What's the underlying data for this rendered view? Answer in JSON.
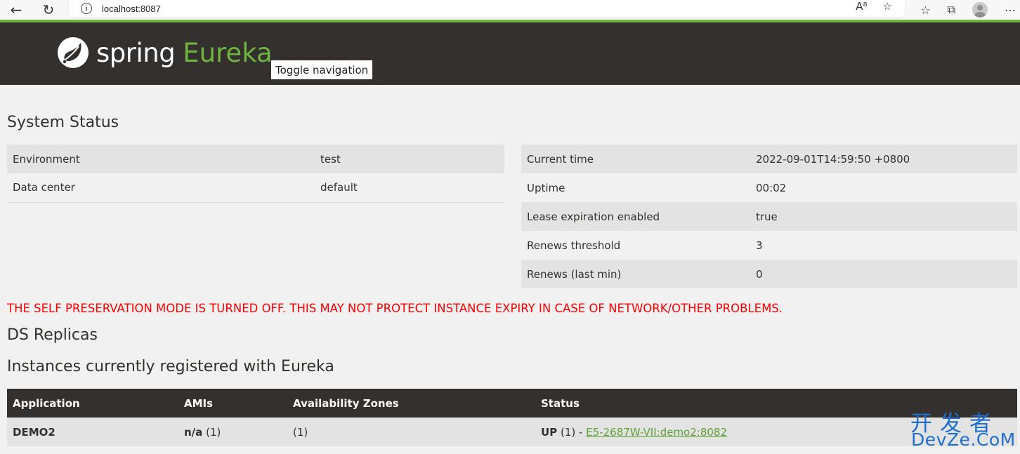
{
  "browser": {
    "url": "localhost:8087"
  },
  "brand": {
    "word1": "spring",
    "word2": "Eureka",
    "colors": {
      "header_bg": "#34302d",
      "accent_green": "#6db33f",
      "warning_red": "#ff0000"
    }
  },
  "nav": {
    "toggle_label": "Toggle navigation"
  },
  "system_status": {
    "title": "System Status",
    "left_rows": [
      {
        "label": "Environment",
        "value": "test"
      },
      {
        "label": "Data center",
        "value": "default"
      }
    ],
    "right_rows": [
      {
        "label": "Current time",
        "value": "2022-09-01T14:59:50 +0800"
      },
      {
        "label": "Uptime",
        "value": "00:02"
      },
      {
        "label": "Lease expiration enabled",
        "value": "true"
      },
      {
        "label": "Renews threshold",
        "value": "3"
      },
      {
        "label": "Renews (last min)",
        "value": "0"
      }
    ]
  },
  "warning": {
    "text": "THE SELF PRESERVATION MODE IS TURNED OFF. THIS MAY NOT PROTECT INSTANCE EXPIRY IN CASE OF NETWORK/OTHER PROBLEMS."
  },
  "ds_replicas": {
    "title": "DS Replicas"
  },
  "instances": {
    "title": "Instances currently registered with Eureka",
    "headers": [
      "Application",
      "AMIs",
      "Availability Zones",
      "Status"
    ],
    "rows": [
      {
        "application": "DEMO2",
        "amis_label": "n/a",
        "amis_count": "(1)",
        "zones": "(1)",
        "status_label": "UP",
        "status_count": "(1) - ",
        "instance_link": "E5-2687W-VII:demo2:8082"
      }
    ]
  },
  "watermark": {
    "line1": "开发者",
    "line2": "DevZe.CoM"
  }
}
